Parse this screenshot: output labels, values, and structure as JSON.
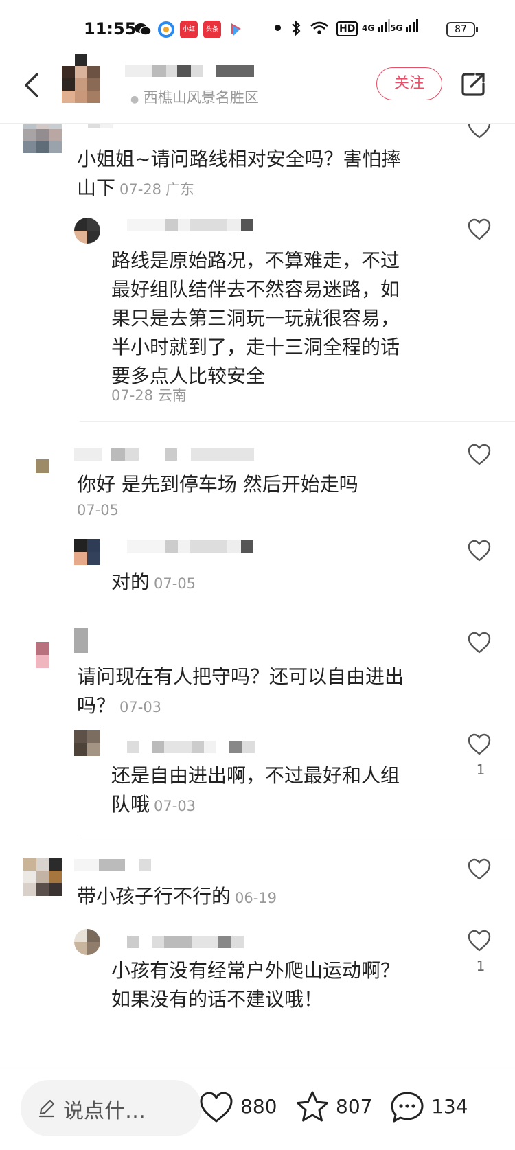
{
  "status_bar": {
    "time": "11:55",
    "apps": [
      "wechat-icon",
      "qq-browser-icon",
      "xiaohongshu-icon",
      "toutiao-icon",
      "bili-icon"
    ],
    "app_labels": {
      "xhs": "小红书",
      "toutiao": "头条"
    },
    "network": [
      "bluetooth-icon",
      "wifi-icon",
      "HD",
      "4G",
      "5G"
    ],
    "battery": "87"
  },
  "header": {
    "location": "西樵山风景名胜区",
    "follow_label": "关注"
  },
  "comments": [
    {
      "text": "小姐姐~请问路线相对安全吗？害怕摔山下",
      "date": "07-28",
      "region": "广东"
    },
    {
      "text": "路线是原始路况，不算难走，不过最好组队结伴去不然容易迷路，如果只是去第三洞玩一玩就很容易，半小时就到了，走十三洞全程的话要多点人比较安全",
      "date": "07-28",
      "region": "云南"
    },
    {
      "text": "你好 是先到停车场 然后开始走吗",
      "date": "07-05"
    },
    {
      "text": "对的",
      "date": "07-05"
    },
    {
      "text": "请问现在有人把守吗？还可以自由进出吗？",
      "date": "07-03"
    },
    {
      "text": "还是自由进出啊，不过最好和人组队哦",
      "date": "07-03",
      "likes": "1"
    },
    {
      "text": "带小孩子行不行的",
      "date": "06-19"
    },
    {
      "text": "小孩有没有经常户外爬山运动啊？如果没有的话不建议哦！",
      "likes": "1"
    }
  ],
  "bottom_bar": {
    "input_placeholder": "说点什…",
    "likes": "880",
    "favorites": "807",
    "comments": "134"
  },
  "colors": {
    "accent": "#e8506a",
    "meta_text": "#999999",
    "divider": "#eeeeee"
  }
}
